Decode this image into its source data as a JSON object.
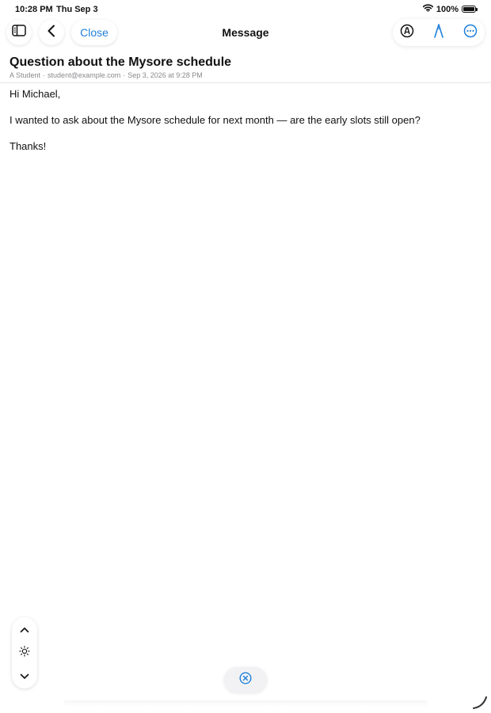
{
  "status_bar": {
    "time": "10:28 PM",
    "date": "Thu Sep 3",
    "battery": "100%",
    "battery_level": 1.0
  },
  "toolbar": {
    "title": "Message",
    "close_label": "Close",
    "icons": [
      "sidebar-icon",
      "back-chevron-icon",
      "markup-icon",
      "pen-icon",
      "more-icon"
    ]
  },
  "message": {
    "subject": "Question about the Mysore schedule",
    "sender": "A Student",
    "email": "student@example.com",
    "date": "Sep 3, 2026 at 9:28 PM",
    "meta_separator": "·",
    "body": {
      "greeting": "Hi Michael,",
      "paragraph": "I wanted to ask about the Mysore schedule for next month — are the early slots still open?",
      "closing": "Thanks!"
    }
  },
  "controls": {
    "zoom_icons": [
      "chevron-up-icon",
      "brightness-icon",
      "chevron-down-icon"
    ],
    "bottom_icon": "close-circle-icon"
  },
  "colors": {
    "accent": "#1e7fd9",
    "text": "#111111",
    "meta": "#8a8a8e"
  }
}
